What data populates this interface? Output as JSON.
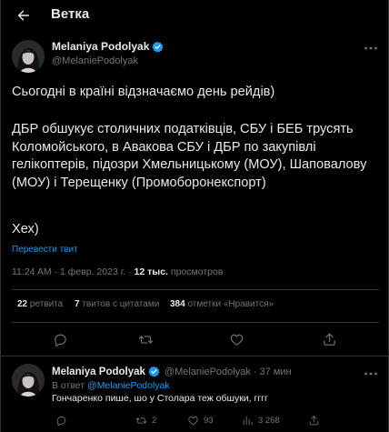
{
  "header": {
    "title": "Ветка"
  },
  "main_tweet": {
    "author_name": "Melaniya Podolyak",
    "handle": "@MelaniePodolyak",
    "text_line1": "Сьогодні в країні відзначаємо день рейдів)",
    "text_para2": "ДБР обшукує столичних податківців, СБУ і БЕБ трусять Коломойського, в Авакова СБУ і ДБР по закупівлі гелікоптерів, підозри Хмельницькому (МОУ), Шаповалову (МОУ) і Терещенку (Промоборонекспорт)",
    "text_line3": "Хех)",
    "translate_label": "Перевести твит",
    "time": "11:24 AM",
    "date": "1 февр. 2023 г.",
    "views_count": "12 тыс.",
    "views_label": "просмотров",
    "retweets_count": "22",
    "retweets_label": "ретвита",
    "quotes_count": "7",
    "quotes_label": "твитов с цитатами",
    "likes_count": "384",
    "likes_label": "отметки «Нравится»",
    "separator": "·"
  },
  "reply_tweet": {
    "author_name": "Melaniya Podolyak",
    "handle": "@MelaniePodolyak",
    "time": "37 мин",
    "separator": "·",
    "reply_prefix": "В ответ",
    "reply_to": "@MelaniePodolyak",
    "text": "Гончаренко пише, шо у Столара теж обшуки, гггг",
    "retweets": "2",
    "likes": "93",
    "views": "3 268"
  },
  "colors": {
    "background": "#000000",
    "text": "#e7e9ea",
    "muted": "#71767b",
    "link": "#1d9bf0",
    "divider": "#2f3336",
    "verified": "#1d9bf0"
  },
  "icons": [
    "back-arrow-icon",
    "verified-badge-icon",
    "more-icon",
    "reply-icon",
    "retweet-icon",
    "like-icon",
    "share-icon",
    "views-icon"
  ]
}
